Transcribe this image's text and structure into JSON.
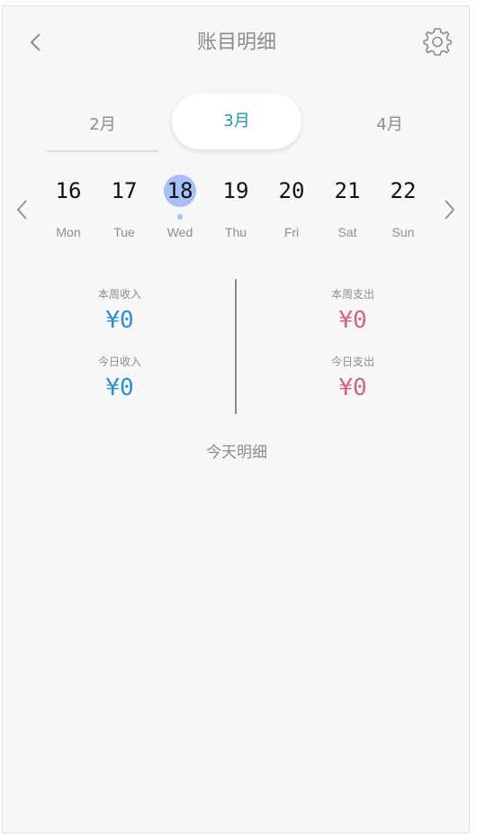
{
  "header": {
    "title": "账目明细",
    "back_icon": "chevron-left-icon",
    "settings_icon": "gear-icon"
  },
  "months": [
    {
      "label": "2月",
      "selected": false
    },
    {
      "label": "3月",
      "selected": true
    },
    {
      "label": "4月",
      "selected": false
    }
  ],
  "week": {
    "prev_icon": "chevron-left-icon",
    "next_icon": "chevron-right-icon",
    "days": [
      {
        "num": "16",
        "name": "Mon"
      },
      {
        "num": "17",
        "name": "Tue"
      },
      {
        "num": "18",
        "name": "Wed",
        "selected": true
      },
      {
        "num": "19",
        "name": "Thu"
      },
      {
        "num": "20",
        "name": "Fri"
      },
      {
        "num": "21",
        "name": "Sat"
      },
      {
        "num": "22",
        "name": "Sun"
      }
    ]
  },
  "stats": {
    "week_income_label": "本周收入",
    "week_income_value": "¥0",
    "today_income_label": "今日收入",
    "today_income_value": "¥0",
    "week_expense_label": "本周支出",
    "week_expense_value": "¥0",
    "today_expense_label": "今日支出",
    "today_expense_value": "¥0"
  },
  "today_detail_label": "今天明细",
  "colors": {
    "accent": "#1f94c5",
    "income": "#2b8fd0",
    "expense": "#d6617f",
    "selected_day": "#a7c0f7"
  }
}
